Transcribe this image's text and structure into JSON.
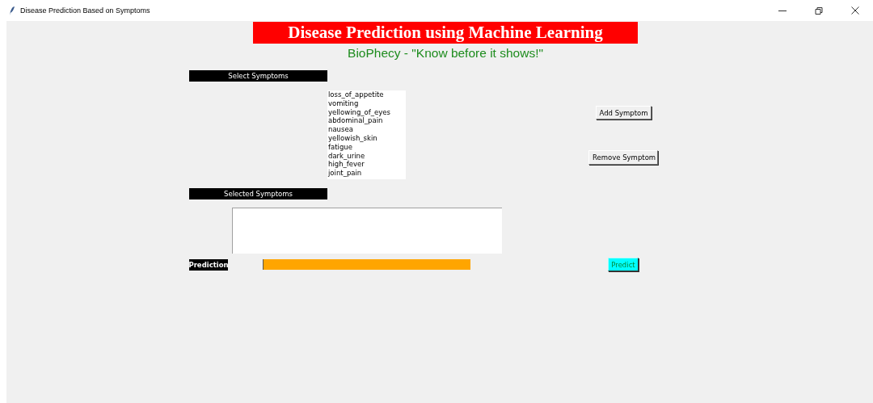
{
  "window": {
    "title": "Disease Prediction Based on Symptoms"
  },
  "header": {
    "title": "Disease Prediction using Machine Learning",
    "subtitle": "BioPhecy - \"Know before it shows!\""
  },
  "select_label": "Select Symptoms",
  "symptom_list": {
    "items": [
      "loss_of_appetite",
      "vomiting",
      "yellowing_of_eyes",
      "abdominal_pain",
      "nausea",
      "yellowish_skin",
      "fatigue",
      "dark_urine",
      "high_fever",
      "joint_pain"
    ]
  },
  "buttons": [
    {
      "label": "Add Symptom"
    },
    {
      "label": "Remove Symptom"
    }
  ],
  "selected_label": "Selected Symptoms",
  "prediction_label": "Prediction",
  "predict_button": "Predict"
}
